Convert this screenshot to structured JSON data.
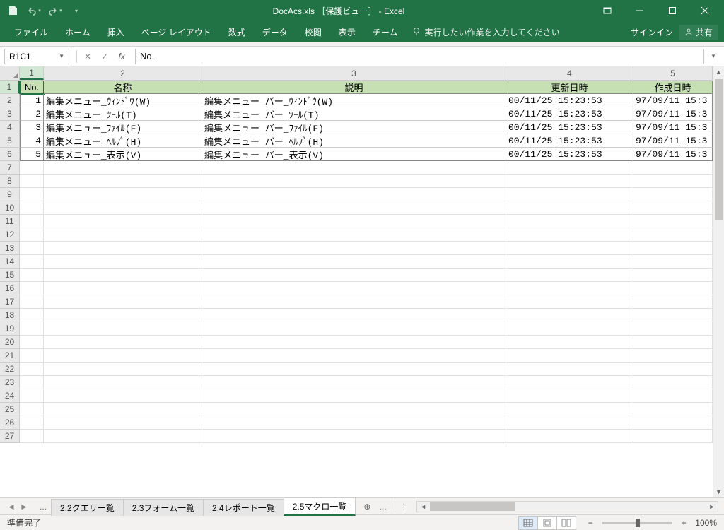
{
  "title": "DocAcs.xls ［保護ビュー］ - Excel",
  "qat": {
    "save": "save-icon",
    "undo": "undo-icon",
    "redo": "redo-icon"
  },
  "ribbon": {
    "tabs": [
      "ファイル",
      "ホーム",
      "挿入",
      "ページ レイアウト",
      "数式",
      "データ",
      "校閲",
      "表示",
      "チーム"
    ],
    "tellme": "実行したい作業を入力してください",
    "signin": "サインイン",
    "share": "共有"
  },
  "namebox": "R1C1",
  "formula": "No.",
  "columns": [
    "1",
    "2",
    "3",
    "4",
    "5"
  ],
  "headers": [
    "No.",
    "名称",
    "説明",
    "更新日時",
    "作成日時"
  ],
  "rows": [
    {
      "no": "1",
      "name": "編集メニュー_ｳｨﾝﾄﾞｳ(W)",
      "desc": "編集メニュー バー_ｳｨﾝﾄﾞｳ(W)",
      "upd": "00/11/25 15:23:53",
      "crt": "97/09/11 15:3"
    },
    {
      "no": "2",
      "name": "編集メニュー_ﾂｰﾙ(T)",
      "desc": "編集メニュー バー_ﾂｰﾙ(T)",
      "upd": "00/11/25 15:23:53",
      "crt": "97/09/11 15:3"
    },
    {
      "no": "3",
      "name": "編集メニュー_ﾌｧｲﾙ(F)",
      "desc": "編集メニュー バー_ﾌｧｲﾙ(F)",
      "upd": "00/11/25 15:23:53",
      "crt": "97/09/11 15:3"
    },
    {
      "no": "4",
      "name": "編集メニュー_ﾍﾙﾌﾟ(H)",
      "desc": "編集メニュー バー_ﾍﾙﾌﾟ(H)",
      "upd": "00/11/25 15:23:53",
      "crt": "97/09/11 15:3"
    },
    {
      "no": "5",
      "name": "編集メニュー_表示(V)",
      "desc": "編集メニュー バー_表示(V)",
      "upd": "00/11/25 15:23:53",
      "crt": "97/09/11 15:3"
    }
  ],
  "emptyRows": 21,
  "sheets": {
    "ellipsis": "...",
    "tabs": [
      "2.2クエリー覧",
      "2.3フォーム一覧",
      "2.4レポート一覧",
      "2.5マクロ一覧"
    ],
    "activeIndex": 3
  },
  "status": {
    "ready": "準備完了",
    "zoom": "100%"
  }
}
